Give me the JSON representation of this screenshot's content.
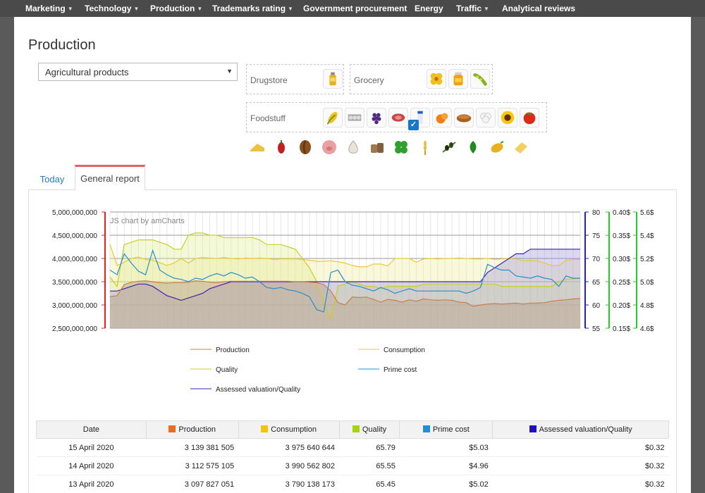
{
  "nav": {
    "items": [
      {
        "label": "Marketing",
        "dropdown": true
      },
      {
        "label": "Technology",
        "dropdown": true
      },
      {
        "label": "Production",
        "dropdown": true
      },
      {
        "label": "Trademarks rating",
        "dropdown": true
      },
      {
        "label": "Government procurement",
        "dropdown": false
      },
      {
        "label": "Energy",
        "dropdown": false
      },
      {
        "label": "Traffic",
        "dropdown": true
      },
      {
        "label": "Analytical reviews",
        "dropdown": false
      }
    ]
  },
  "page": {
    "title": "Production",
    "select_value": "Agricultural products"
  },
  "categories": {
    "drugstore": "Drugstore",
    "grocery": "Grocery",
    "foodstuff": "Foodstuff"
  },
  "tabs": {
    "today": "Today",
    "general": "General report"
  },
  "chart_data": {
    "type": "line",
    "watermark": "JS chart by amCharts",
    "left_axis": {
      "min": 2500000000,
      "max": 5000000000,
      "ticks": [
        "5,000,000,000",
        "4,500,000,000",
        "4,000,000,000",
        "3,500,000,000",
        "3,000,000,000",
        "2,500,000,000"
      ],
      "color": "#e02020"
    },
    "right_axes": [
      {
        "ticks": [
          "80",
          "75",
          "70",
          "65",
          "60",
          "55"
        ],
        "color": "#2020d0"
      },
      {
        "ticks": [
          "0.40$",
          "0.35$",
          "0.30$",
          "0.25$",
          "0.20$",
          "0.15$"
        ],
        "color": "#22cc22"
      },
      {
        "ticks": [
          "5.6$",
          "5.4$",
          "5.2$",
          "5.0$",
          "4.8$",
          "4.6$"
        ],
        "color": "#22cc22"
      }
    ],
    "series": [
      {
        "name": "Production",
        "color": "#c8804a",
        "axis": "left",
        "values": [
          3180,
          3200,
          3440,
          3490,
          3510,
          3520,
          3500,
          3480,
          3470,
          3480,
          3480,
          3490,
          3520,
          3510,
          3490,
          3480,
          3500,
          3510,
          3510,
          3510,
          3510,
          3510,
          3510,
          3510,
          3510,
          3510,
          3500,
          3500,
          3490,
          3480,
          3440,
          3300,
          3050,
          3000,
          3170,
          3160,
          3170,
          3120,
          3060,
          3120,
          3100,
          3060,
          3110,
          3080,
          3130,
          3110,
          3100,
          3110,
          3100,
          3060,
          3050,
          2970,
          3000,
          3020,
          3030,
          3020,
          3030,
          3040,
          3020,
          3040,
          3040,
          3050,
          3080,
          3100,
          3110,
          3130,
          3139
        ]
      },
      {
        "name": "Consumption",
        "color": "#e8c838",
        "axis": "left",
        "values": [
          4300,
          3850,
          3920,
          4000,
          4030,
          3980,
          3960,
          3910,
          3850,
          3900,
          4000,
          3900,
          4000,
          4020,
          4010,
          4000,
          4020,
          4000,
          3990,
          4010,
          4000,
          4010,
          4000,
          3980,
          3990,
          3990,
          3990,
          3980,
          3960,
          3940,
          3940,
          3950,
          3930,
          3900,
          3850,
          3820,
          3820,
          3880,
          3880,
          3840,
          4000,
          4000,
          4000,
          3920,
          3990,
          4000,
          3990,
          4000,
          4000,
          4010,
          4000,
          3990,
          3990,
          4000,
          3980,
          3990,
          4000,
          3990,
          3950,
          3960,
          3950,
          3900,
          3850,
          3850,
          3960,
          3980,
          3975
        ]
      },
      {
        "name": "Quality",
        "color": "#c8d020",
        "axis": "r1",
        "values": [
          66,
          64,
          73,
          73.5,
          74,
          74,
          74,
          73.5,
          73,
          72,
          72,
          75,
          75.5,
          75.5,
          75,
          75,
          74.5,
          74.5,
          74.5,
          74.5,
          74.5,
          74,
          73,
          73,
          73,
          72.5,
          72,
          70,
          68,
          65,
          60.5,
          57,
          64,
          64.5,
          65,
          64.5,
          64,
          64,
          63.5,
          64,
          64,
          64,
          64,
          64,
          64.5,
          64.5,
          64.5,
          64.5,
          64.5,
          64.5,
          64.5,
          64.5,
          64.5,
          64.5,
          64.5,
          64,
          64,
          64,
          64,
          64,
          64,
          64,
          64,
          65,
          65.5,
          65.6,
          65.79
        ]
      },
      {
        "name": "Prime cost",
        "color": "#2890c8",
        "axis": "r3",
        "values": [
          5.1,
          5.06,
          5.24,
          5.16,
          5.09,
          5.06,
          5.27,
          5.1,
          5.06,
          5.03,
          5.02,
          5.0,
          5.03,
          5.02,
          5.05,
          5.07,
          5.05,
          5.08,
          5.06,
          5.03,
          5.04,
          5.0,
          4.95,
          4.94,
          4.95,
          4.93,
          4.92,
          4.9,
          4.87,
          4.76,
          4.74,
          5.08,
          5.1,
          5.0,
          4.97,
          4.96,
          4.94,
          4.92,
          4.95,
          4.93,
          4.9,
          4.92,
          4.94,
          4.92,
          4.92,
          4.92,
          4.92,
          4.92,
          4.92,
          4.92,
          4.9,
          4.92,
          4.95,
          5.15,
          5.12,
          5.1,
          5.1,
          5.05,
          5.04,
          5.03,
          5.05,
          5.03,
          5.02,
          4.96,
          5.05,
          5.03,
          5.03
        ]
      },
      {
        "name": "Assessed valuation/Quality",
        "color": "#4020b0",
        "axis": "r2",
        "values": [
          0.23,
          0.23,
          0.235,
          0.24,
          0.245,
          0.245,
          0.24,
          0.23,
          0.22,
          0.215,
          0.21,
          0.215,
          0.22,
          0.225,
          0.235,
          0.24,
          0.245,
          0.25,
          0.25,
          0.25,
          0.25,
          0.25,
          0.25,
          0.25,
          0.25,
          0.25,
          0.25,
          0.25,
          0.25,
          0.25,
          0.25,
          0.25,
          0.25,
          0.25,
          0.25,
          0.25,
          0.25,
          0.25,
          0.25,
          0.25,
          0.25,
          0.25,
          0.25,
          0.25,
          0.25,
          0.25,
          0.25,
          0.25,
          0.25,
          0.25,
          0.25,
          0.25,
          0.25,
          0.27,
          0.28,
          0.29,
          0.3,
          0.31,
          0.31,
          0.32,
          0.32,
          0.32,
          0.32,
          0.32,
          0.32,
          0.32,
          0.32
        ]
      }
    ]
  },
  "legend": {
    "production": "Production",
    "consumption": "Consumption",
    "quality": "Quality",
    "prime_cost": "Prime cost",
    "assessed": "Assessed valuation/Quality"
  },
  "table": {
    "headers": {
      "date": "Date",
      "production": "Production",
      "consumption": "Consumption",
      "quality": "Quality",
      "prime_cost": "Prime cost",
      "assessed": "Assessed valuation/Quality"
    },
    "header_colors": {
      "production": "#ee6a1c",
      "consumption": "#f5c400",
      "quality": "#a6d40a",
      "prime_cost": "#1f8fd6",
      "assessed": "#2010c0"
    },
    "rows": [
      {
        "date": "15 April 2020",
        "production": "3 139 381 505",
        "consumption": "3 975 640 644",
        "quality": "65.79",
        "prime_cost": "$5.03",
        "assessed": "$0.32"
      },
      {
        "date": "14 April 2020",
        "production": "3 112 575 105",
        "consumption": "3 990 562 802",
        "quality": "65.55",
        "prime_cost": "$4.96",
        "assessed": "$0.32"
      },
      {
        "date": "13 April 2020",
        "production": "3 097 827 051",
        "consumption": "3 790 138 173",
        "quality": "65.45",
        "prime_cost": "$5.02",
        "assessed": "$0.32"
      }
    ]
  }
}
